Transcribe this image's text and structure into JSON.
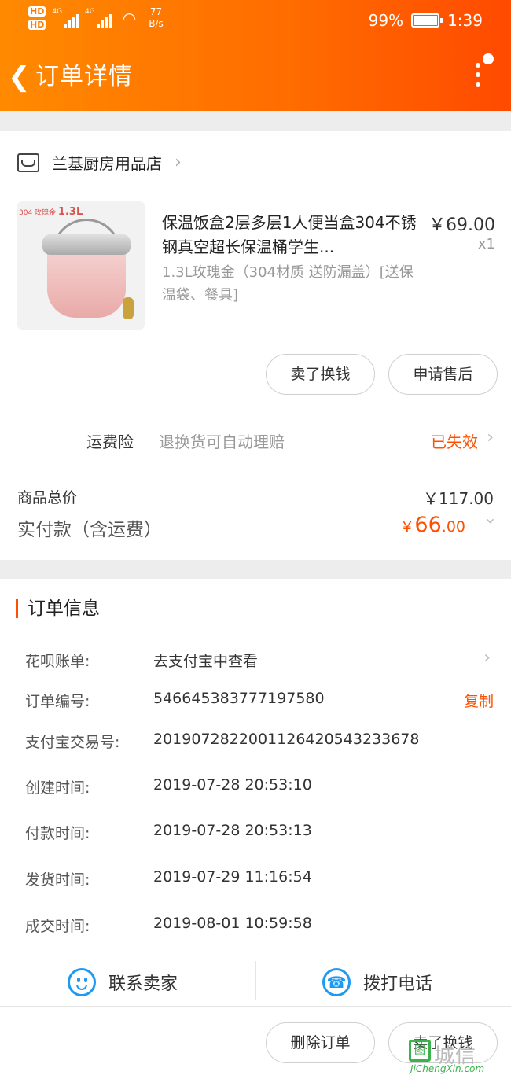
{
  "status_bar": {
    "hd1": "HD",
    "hd2": "HD",
    "net1": "4G",
    "net2": "4G",
    "speed_value": "77",
    "speed_unit": "B/s",
    "battery_percent": "99%",
    "battery_level": 0.99,
    "time": "1:39"
  },
  "nav": {
    "back_icon": "chevron-left-icon",
    "title": "订单详情",
    "more_icon": "more-vertical-icon"
  },
  "shop": {
    "name": "兰基厨房用品店"
  },
  "product": {
    "image_tag_small": "304 玫瑰金",
    "image_tag_big": "1.3L",
    "title": "保温饭盒2层多层1人便当盒304不锈钢真空超长保温桶学生...",
    "price": "￥69.00",
    "quantity": "x1",
    "spec": "1.3L玫瑰金（304材质 送防漏盖）[送保温袋、餐具]"
  },
  "product_actions": {
    "sell_label": "卖了换钱",
    "after_sale_label": "申请售后"
  },
  "insurance": {
    "label": "运费险",
    "desc": "退换货可自动理赔",
    "status": "已失效"
  },
  "pricing": {
    "total_label": "商品总价",
    "total_value": "￥117.00",
    "paid_label": "实付款（含运费）",
    "paid_yen": "￥",
    "paid_int": "66",
    "paid_dec": ".00"
  },
  "order_info": {
    "section_title": "订单信息",
    "huabei_label": "花呗账单:",
    "huabei_value": "去支付宝中查看",
    "order_no_label": "订单编号:",
    "order_no_value": "546645383777197580",
    "copy_label": "复制",
    "alipay_label": "支付宝交易号:",
    "alipay_value": "2019072822001126420543233678",
    "created_label": "创建时间:",
    "created_value": "2019-07-28 20:53:10",
    "paid_label": "付款时间:",
    "paid_value": "2019-07-28 20:53:13",
    "shipped_label": "发货时间:",
    "shipped_value": "2019-07-29 11:16:54",
    "done_label": "成交时间:",
    "done_value": "2019-08-01 10:59:58"
  },
  "contact": {
    "seller_label": "联系卖家",
    "phone_label": "拨打电话"
  },
  "bottom_actions": {
    "delete_label": "删除订单",
    "sell_label": "卖了换钱"
  },
  "watermark": {
    "glyph": "图",
    "text": "城信",
    "url": "JiChengXin.com"
  },
  "colors": {
    "accent": "#ff5000",
    "header_start": "#ff8a00",
    "header_end": "#ff4a00",
    "link_blue": "#1e9bf0"
  }
}
